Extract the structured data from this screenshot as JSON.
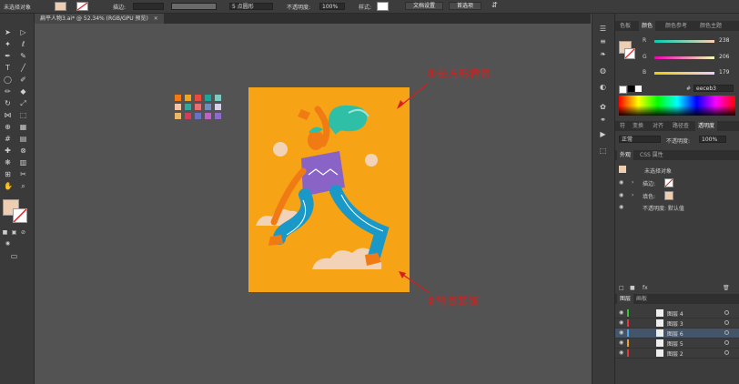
{
  "control_bar": {
    "selection": "未选择对象",
    "stroke_label": "描边:",
    "brush": "5 点圆形",
    "opacity_label": "不透明度:",
    "opacity_value": "100%",
    "style_label": "样式:",
    "doc_setup": "文档设置",
    "preferences": "首选项"
  },
  "document": {
    "tab_title": "扁平人物3.ai* @ 52.34% (RGB/GPU 预览)"
  },
  "annotations": {
    "background": "①长方形背景",
    "decoration": "②背景装饰"
  },
  "swatch_colors": [
    "#f07a14",
    "#f1a51d",
    "#e84c3d",
    "#16a99b",
    "#7ec9c0",
    "#f2c6a8",
    "#2baa9f",
    "#e86f73",
    "#6d8ec3",
    "#d6d1e8",
    "#e8b96a",
    "#d73b5c",
    "#6a73bf",
    "#c061c9",
    "#8b6cc9"
  ],
  "color_panel": {
    "tabs": [
      "色板",
      "颜色",
      "颜色参考",
      "颜色主题"
    ],
    "r_label": "R",
    "r_value": "238",
    "g_label": "G",
    "g_value": "206",
    "b_label": "B",
    "b_value": "179",
    "hex_label": "#",
    "hex_value": "eeceb3",
    "fill_color": "#eeceb3"
  },
  "transparency_panel": {
    "tabs": [
      "符",
      "变换",
      "对齐",
      "路径查",
      "透明度"
    ],
    "mode": "正常",
    "opacity_label": "不透明度:",
    "opacity_value": "100%"
  },
  "appearance_panel": {
    "tabs": [
      "外观",
      "CSS 属性"
    ],
    "title": "未选择对象",
    "stroke_label": "描边:",
    "fill_label": "填色:",
    "opacity_row": "不透明度: 默认值"
  },
  "layers_panel": {
    "tabs": [
      "图层",
      "画板"
    ],
    "layers": [
      {
        "name": "图层 4",
        "color": "#35c435"
      },
      {
        "name": "图层 3",
        "color": "#e23a3a"
      },
      {
        "name": "图层 6",
        "color": "#4fa3e8"
      },
      {
        "name": "图层 5",
        "color": "#e8a030"
      },
      {
        "name": "图层 2",
        "color": "#e23a3a"
      }
    ]
  }
}
